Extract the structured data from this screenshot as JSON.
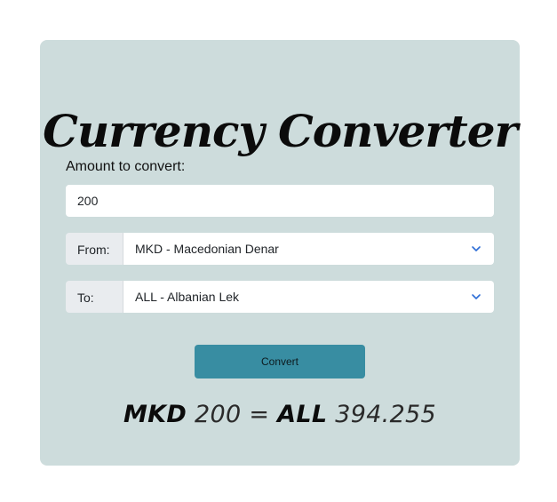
{
  "title": "Currency Converter",
  "amount": {
    "label": "Amount to convert:",
    "value": "200"
  },
  "from": {
    "label": "From:",
    "selected": "MKD - Macedonian Denar"
  },
  "to": {
    "label": "To:",
    "selected": "ALL - Albanian Lek"
  },
  "convert_button": "Convert",
  "result": {
    "from_code": "MKD",
    "amount": "200",
    "equals": "=",
    "to_code": "ALL",
    "converted": "394.255"
  },
  "colors": {
    "card_background": "#cddcdc",
    "button": "#388da2",
    "chevron": "#2d6dd6"
  }
}
